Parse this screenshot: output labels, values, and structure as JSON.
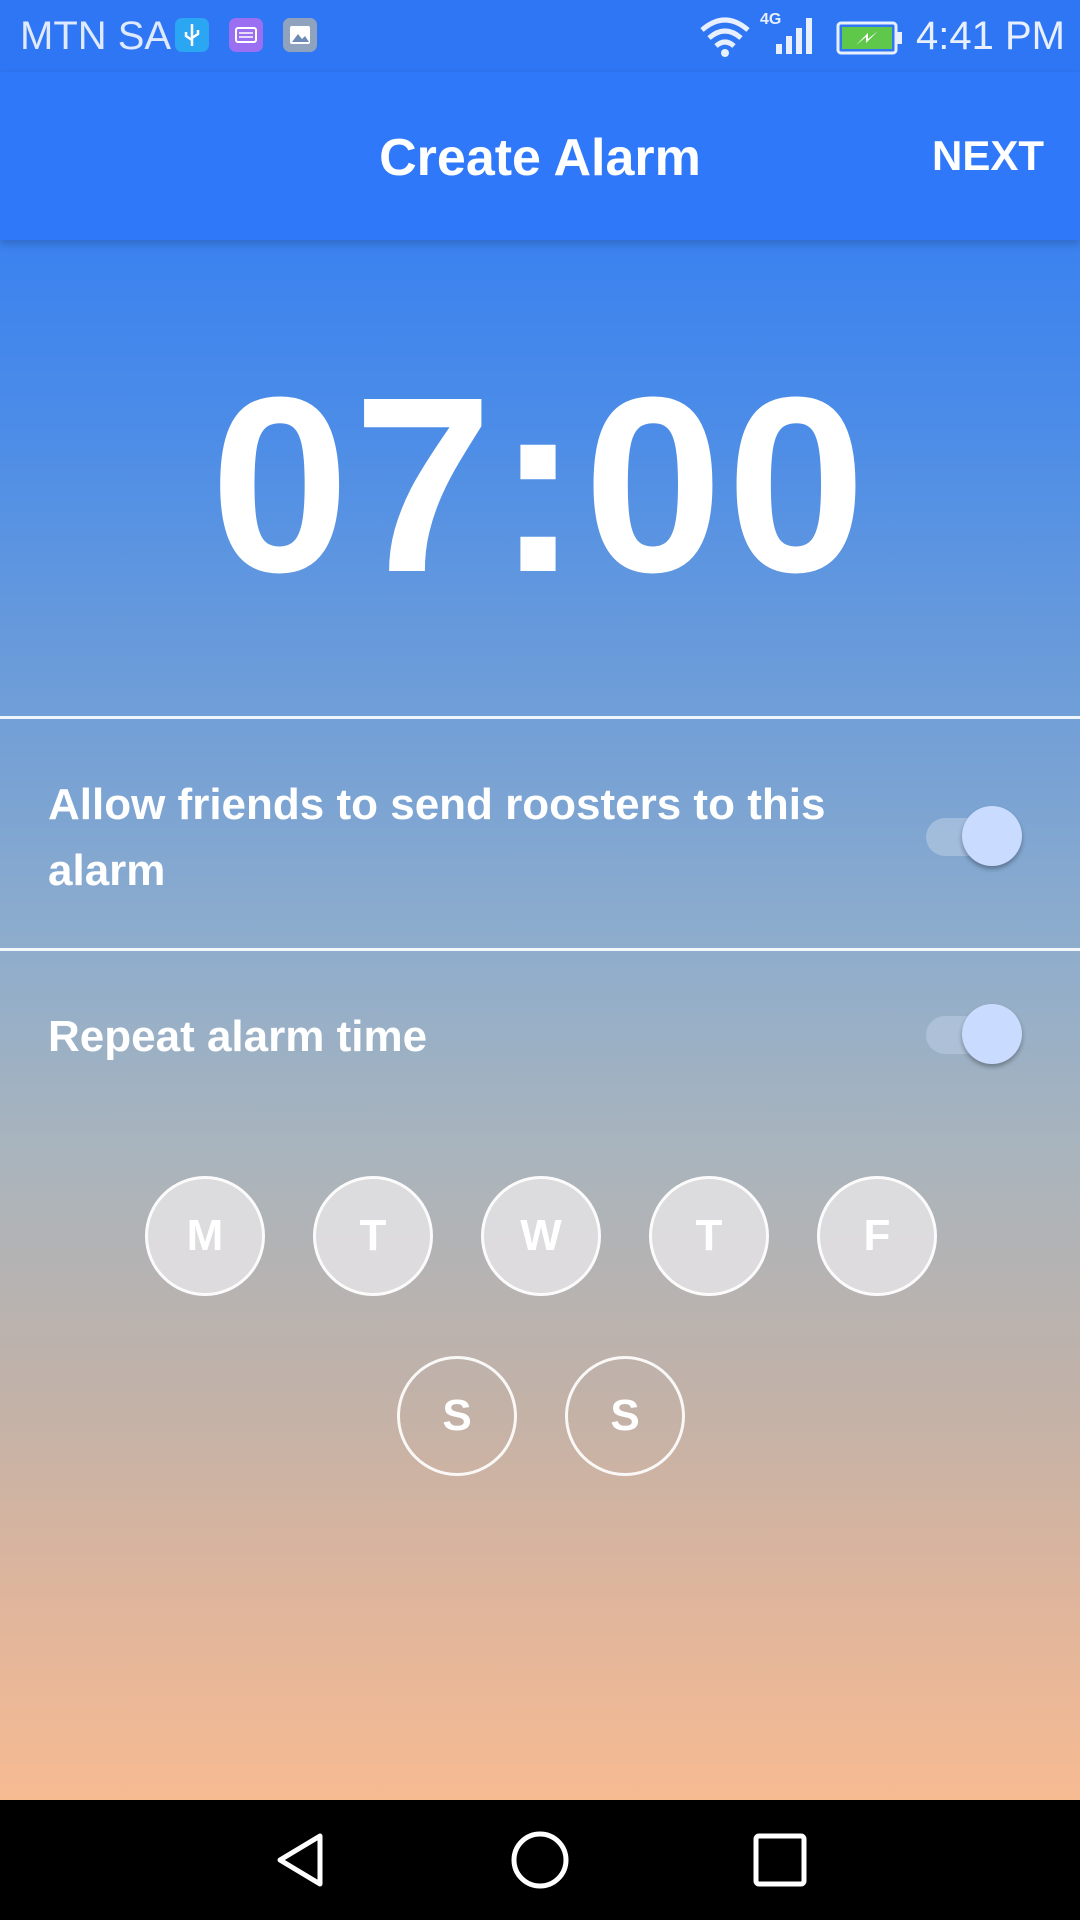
{
  "status_bar": {
    "carrier": "MTN SA",
    "network": "4G",
    "time": "4:41 PM",
    "icons": [
      "usb-icon",
      "keyboard-icon",
      "image-icon",
      "wifi-icon",
      "signal-icon",
      "battery-charging-icon"
    ]
  },
  "app_bar": {
    "title": "Create Alarm",
    "next_label": "NEXT"
  },
  "alarm": {
    "time": "07:00"
  },
  "settings": {
    "allow_friends_label": "Allow friends to send roosters to this alarm",
    "allow_friends_enabled": true,
    "repeat_label": "Repeat alarm time",
    "repeat_enabled": true
  },
  "days": [
    {
      "label": "M",
      "selected": true
    },
    {
      "label": "T",
      "selected": true
    },
    {
      "label": "W",
      "selected": true
    },
    {
      "label": "T",
      "selected": true
    },
    {
      "label": "F",
      "selected": true
    },
    {
      "label": "S",
      "selected": false
    },
    {
      "label": "S",
      "selected": false
    }
  ],
  "nav_bar": {
    "icons": [
      "back-icon",
      "home-icon",
      "recents-icon"
    ]
  },
  "colors": {
    "app_bar": "#2f78fa",
    "gradient_top": "#3b82f0",
    "gradient_bottom": "#f7bb92",
    "toggle_thumb": "#c9dbff"
  }
}
